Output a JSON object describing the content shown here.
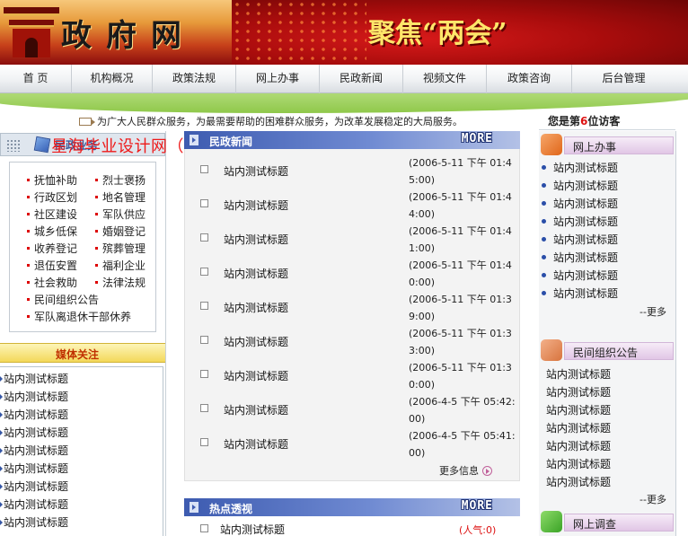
{
  "banner": {
    "title": "政府网",
    "slogan": "聚焦“两会”"
  },
  "nav": {
    "items": [
      "首 页",
      "机构概况",
      "政策法规",
      "网上办事",
      "民政新闻",
      "视频文件",
      "政策咨询",
      "后台管理"
    ]
  },
  "notice": {
    "text": "为广大人民群众服务，为最需要帮助的困难群众服务，为改革发展稳定的大局服务。",
    "visitor_prefix": "您是第",
    "visitor_number": "6",
    "visitor_suffix": "位访客"
  },
  "watermark": "星海毕业设计网（www.helpsj.cn）",
  "left": {
    "header": "民政业务",
    "categories": [
      [
        "抚恤补助",
        "烈士褒扬"
      ],
      [
        "行政区划",
        "地名管理"
      ],
      [
        "社区建设",
        "军队供应"
      ],
      [
        "城乡低保",
        "婚姻登记"
      ],
      [
        "收养登记",
        "殡葬管理"
      ],
      [
        "退伍安置",
        "福利企业"
      ],
      [
        "社会救助",
        "法律法规"
      ],
      [
        "民间组织公告"
      ],
      [
        "军队离退休干部休养"
      ]
    ],
    "media_header": "媒体关注",
    "media_items": [
      "站内测试标题",
      "站内测试标题",
      "站内测试标题",
      "站内测试标题",
      "站内测试标题",
      "站内测试标题",
      "站内测试标题",
      "站内测试标题",
      "站内测试标题"
    ]
  },
  "news": {
    "header": "民政新闻",
    "more_label": "MORE",
    "items": [
      {
        "title": "站内测试标题",
        "date": "(2006-5-11 下午 01:45:00)"
      },
      {
        "title": "站内测试标题",
        "date": "(2006-5-11 下午 01:44:00)"
      },
      {
        "title": "站内测试标题",
        "date": "(2006-5-11 下午 01:41:00)"
      },
      {
        "title": "站内测试标题",
        "date": "(2006-5-11 下午 01:40:00)"
      },
      {
        "title": "站内测试标题",
        "date": "(2006-5-11 下午 01:39:00)"
      },
      {
        "title": "站内测试标题",
        "date": "(2006-5-11 下午 01:33:00)"
      },
      {
        "title": "站内测试标题",
        "date": "(2006-5-11 下午 01:30:00)"
      },
      {
        "title": "站内测试标题",
        "date": "(2006-4-5 下午 05:42:00)"
      },
      {
        "title": "站内测试标题",
        "date": "(2006-4-5 下午 05:41:00)"
      }
    ],
    "more_info": "更多信息"
  },
  "hot": {
    "header": "热点透视",
    "more_label": "MORE",
    "items": [
      {
        "title": "站内测试标题",
        "popularity": "(人气:0)"
      }
    ]
  },
  "right": {
    "online_header": "网上办事",
    "online_items": [
      "站内测试标题",
      "站内测试标题",
      "站内测试标题",
      "站内测试标题",
      "站内测试标题",
      "站内测试标题",
      "站内测试标题",
      "站内测试标题"
    ],
    "online_more": "--更多",
    "org_header": "民间组织公告",
    "org_items": [
      "站内测试标题",
      "站内测试标题",
      "站内测试标题",
      "站内测试标题",
      "站内测试标题",
      "站内测试标题",
      "站内测试标题"
    ],
    "org_more": "--更多",
    "survey_header": "网上调查"
  },
  "colors": {
    "accent_red": "#b30000",
    "nav_blue": "#3d5bb0",
    "highlight": "#d11111"
  }
}
